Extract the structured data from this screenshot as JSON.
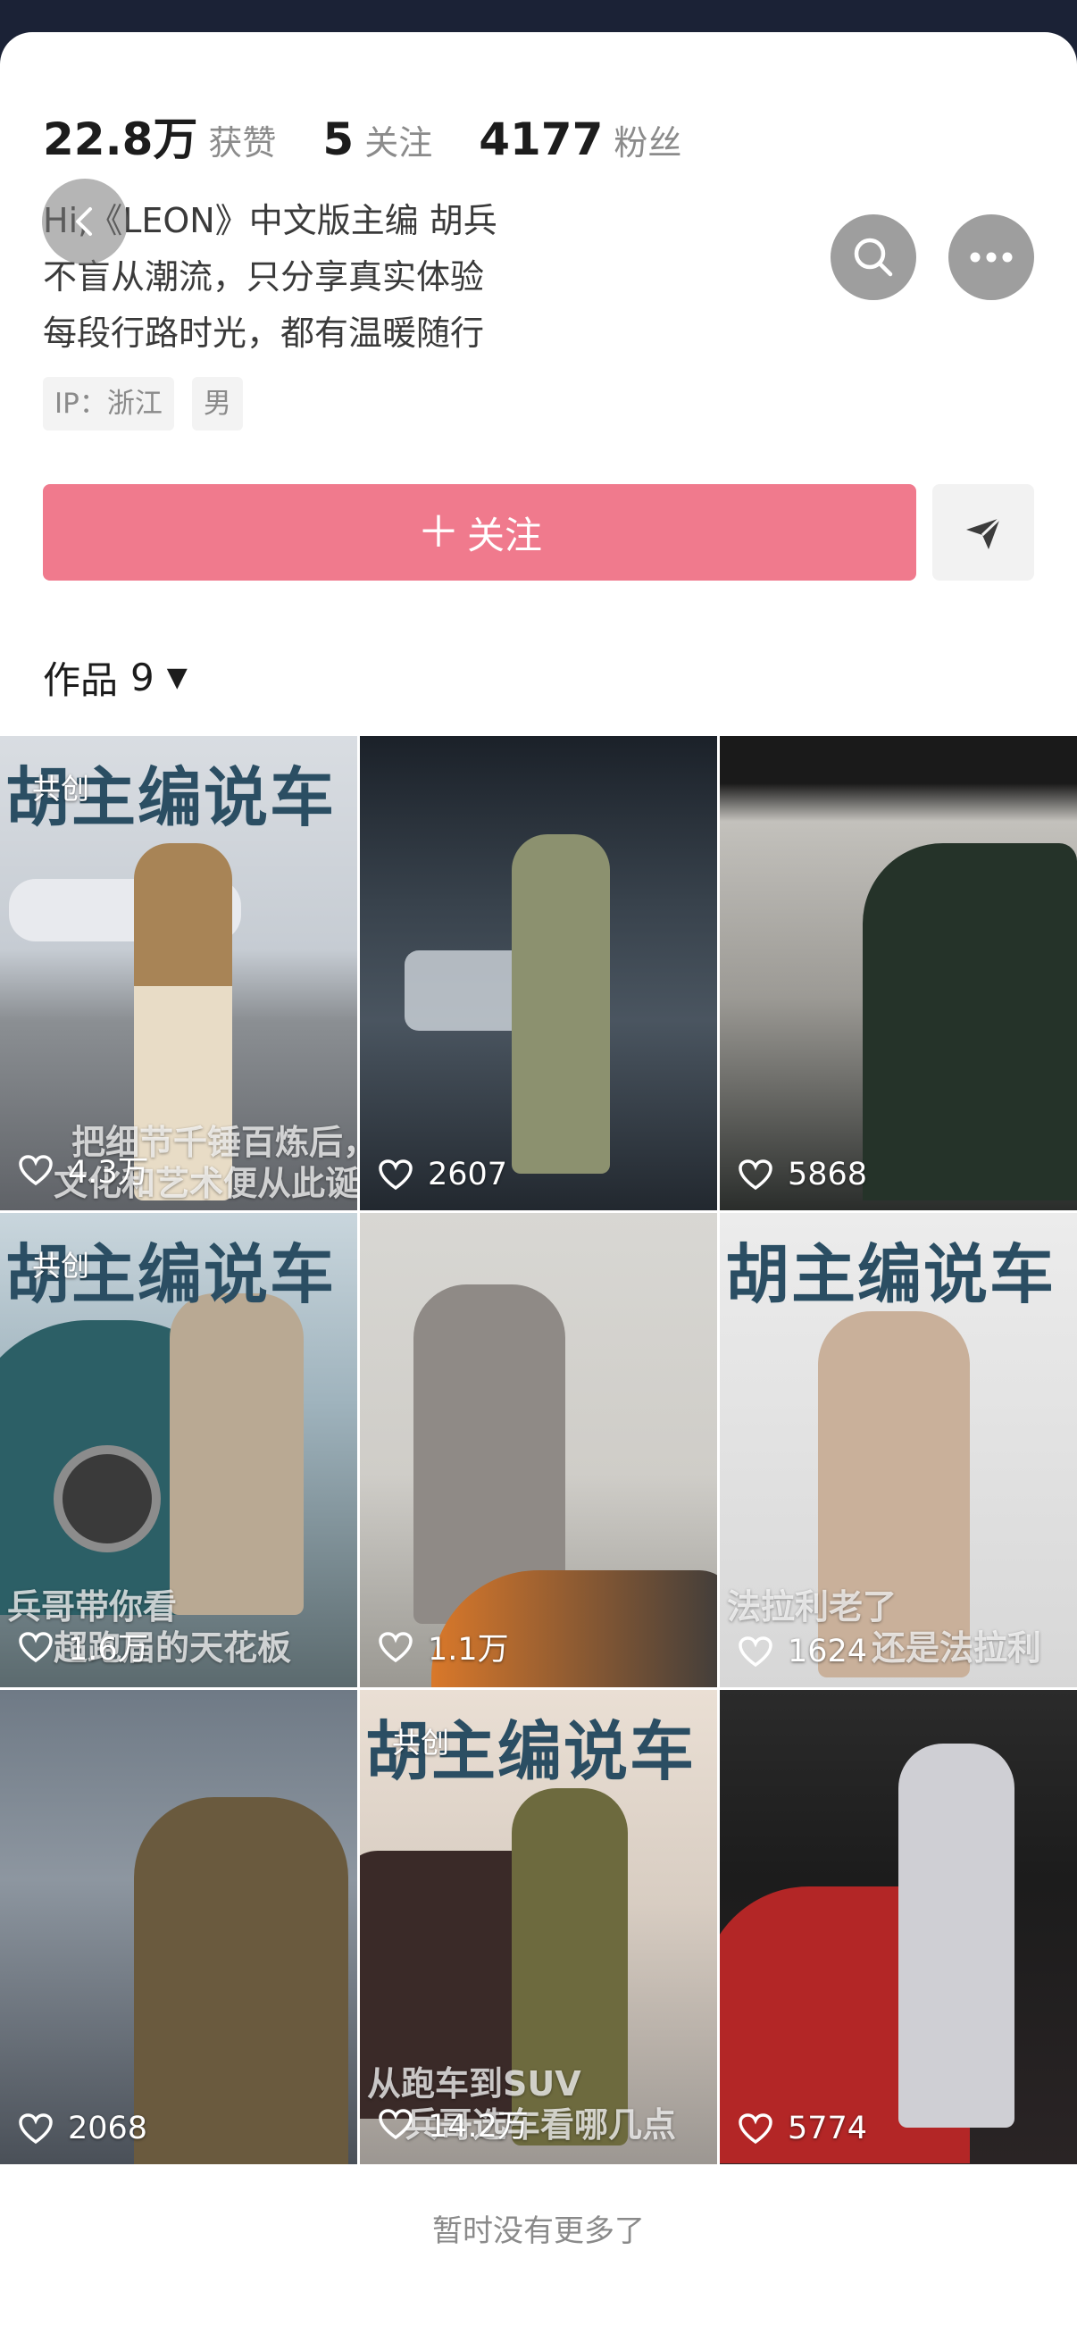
{
  "stats": [
    {
      "num": "22.8万",
      "label": "获赞"
    },
    {
      "num": "5",
      "label": "关注"
    },
    {
      "num": "4177",
      "label": "粉丝"
    }
  ],
  "bio": [
    "Hi,《LEON》中文版主编 胡兵",
    "不盲从潮流，只分享真实体验",
    "每段行路时光，都有温暖随行"
  ],
  "tags": [
    "IP：浙江",
    "男"
  ],
  "follow_label": "关注",
  "works": {
    "label": "作品",
    "count": "9"
  },
  "videos": [
    {
      "likes": "4.3万",
      "badge": "共创",
      "headline": "胡主编说车",
      "overlay": [
        "把细节千锤百炼后，",
        "文化和艺术便从此诞生"
      ]
    },
    {
      "likes": "2607",
      "badge": "",
      "headline": "",
      "overlay": []
    },
    {
      "likes": "5868",
      "badge": "",
      "headline": "",
      "overlay": []
    },
    {
      "likes": "1.6万",
      "badge": "共创",
      "headline": "胡主编说车",
      "overlay": [
        "兵哥带你看",
        "超跑届的天花板"
      ]
    },
    {
      "likes": "1.1万",
      "badge": "",
      "headline": "",
      "overlay": []
    },
    {
      "likes": "1624",
      "badge": "",
      "headline": "胡主编说车",
      "overlay": [
        "法拉利老了",
        "还是法拉利"
      ]
    },
    {
      "likes": "2068",
      "badge": "",
      "headline": "",
      "overlay": []
    },
    {
      "likes": "14.2万",
      "badge": "共创",
      "headline": "胡主编说车",
      "overlay": [
        "从跑车到SUV",
        "兵哥选车看哪几点"
      ]
    },
    {
      "likes": "5774",
      "badge": "",
      "headline": "",
      "overlay": []
    }
  ],
  "footer_message": "暂时没有更多了",
  "colors": {
    "follow_button": "#f07a8d",
    "headline_text": "#2b4e63"
  }
}
